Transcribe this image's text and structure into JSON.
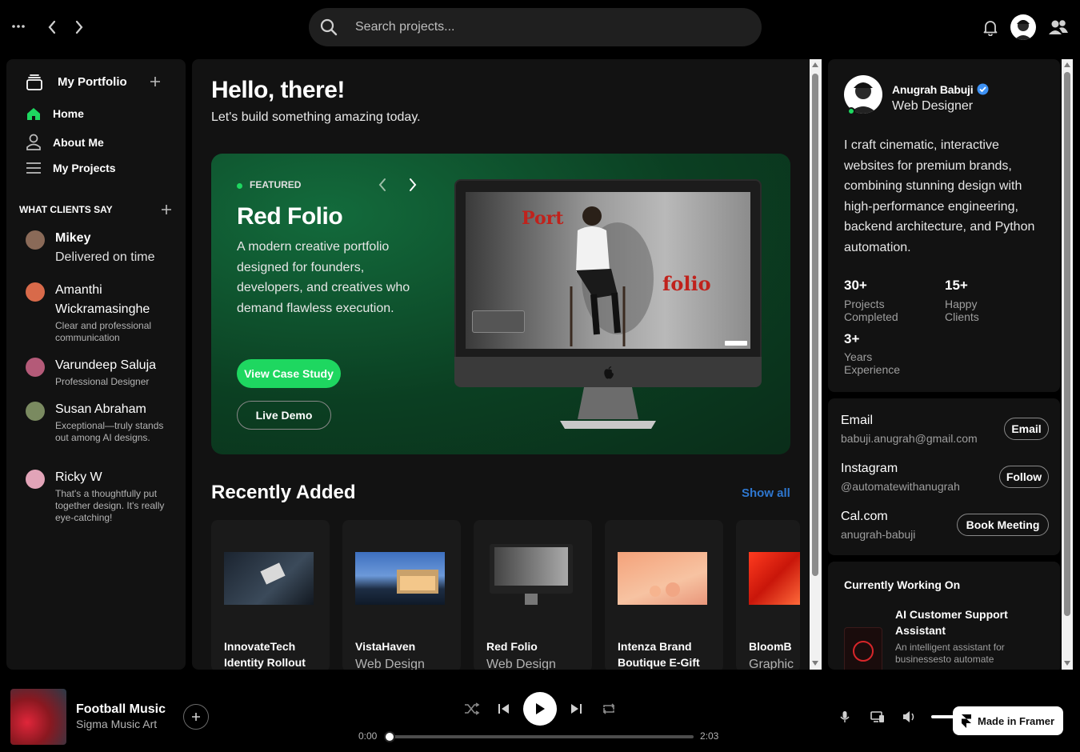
{
  "topbar": {
    "search_placeholder": "Search projects..."
  },
  "sidebar": {
    "title": "My Portfolio",
    "nav": [
      {
        "label": "Home"
      },
      {
        "label": "About Me"
      },
      {
        "label": "My Projects"
      }
    ],
    "section_title": "WHAT CLIENTS SAY",
    "testimonials": [
      {
        "name": "Mikey",
        "text": "Delivered on time"
      },
      {
        "name": "Amanthi Wickramasinghe",
        "text": "Clear and professional communication"
      },
      {
        "name": "Varundeep Saluja",
        "text": "Professional Designer"
      },
      {
        "name": "Susan Abraham",
        "text": "Exceptional—truly stands out among AI designs."
      },
      {
        "name": "Ricky W",
        "text": "That's a thoughtfully put together design. It's really eye-catching!"
      }
    ]
  },
  "main": {
    "greeting": "Hello, there!",
    "subtitle": "Let's build something amazing today.",
    "featured": {
      "badge": "FEATURED",
      "title": "Red Folio",
      "description": "A modern creative portfolio designed for founders, developers, and creatives who demand flawless execution.",
      "primary_button": "View Case Study",
      "secondary_button": "Live Demo",
      "screen_word1": "Port",
      "screen_word2": "folio"
    },
    "recent": {
      "title": "Recently Added",
      "show_all": "Show all",
      "items": [
        {
          "title": "InnovateTech Identity Rollout",
          "subtitle": ""
        },
        {
          "title": "VistaHaven",
          "subtitle": "Web Design"
        },
        {
          "title": "Red Folio",
          "subtitle": "Web Design"
        },
        {
          "title": "Intenza Brand Boutique E-Gift",
          "subtitle": ""
        },
        {
          "title": "BloomB",
          "subtitle": "Graphic"
        }
      ]
    }
  },
  "profile": {
    "name": "Anugrah Babuji",
    "role": "Web Designer",
    "bio": "I craft cinematic, interactive websites for premium brands, combining stunning design with high-performance engineering, backend architecture, and Python automation.",
    "stats": [
      {
        "value": "30+",
        "label": "Projects Completed"
      },
      {
        "value": "15+",
        "label": "Happy Clients"
      },
      {
        "value": "3+",
        "label": "Years Experience"
      }
    ],
    "contacts": [
      {
        "label": "Email",
        "value": "babuji.anugrah@gmail.com",
        "button": "Email"
      },
      {
        "label": "Instagram",
        "value": "@automatewithanugrah",
        "button": "Follow"
      },
      {
        "label": "Cal.com",
        "value": "anugrah-babuji",
        "button": "Book Meeting"
      }
    ],
    "working_on": {
      "title": "Currently Working On",
      "project_title": "AI Customer Support Assistant",
      "project_desc": "An intelligent assistant for businessesto automate"
    }
  },
  "player": {
    "track": "Football Music",
    "artist": "Sigma Music Art",
    "time_current": "0:00",
    "time_total": "2:03",
    "progress": 0.0,
    "badge": "Made in Framer"
  },
  "colors": {
    "accent": "#1ed760",
    "featured_bg": "#0f4a2a",
    "show_all": "#2e77d0",
    "verified": "#3d91f4"
  }
}
